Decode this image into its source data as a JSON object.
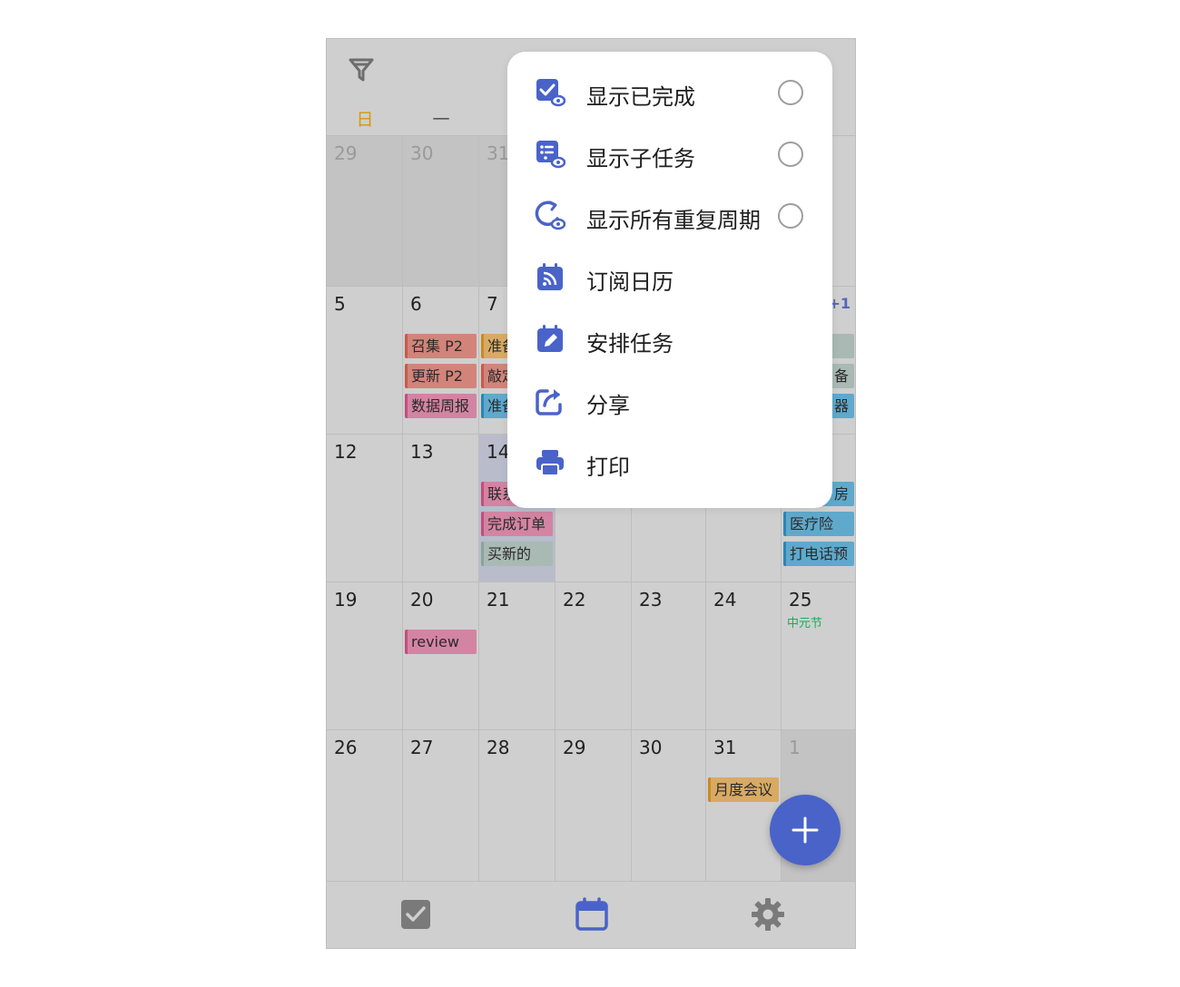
{
  "colors": {
    "accent": "#4a63c9",
    "sunday": "#d49a00",
    "holiday": "#12b05a"
  },
  "header": {
    "filter_icon": "filter-icon",
    "weekdays": [
      "日",
      "一"
    ]
  },
  "calendar": {
    "weeks": [
      [
        {
          "day": "29",
          "out": true
        },
        {
          "day": "30",
          "out": true
        },
        {
          "day": "31",
          "out": true
        },
        {
          "day": ""
        },
        {
          "day": ""
        },
        {
          "day": ""
        },
        {
          "day": ""
        }
      ],
      [
        {
          "day": "5"
        },
        {
          "day": "6",
          "events": [
            {
              "text": "召集 P2",
              "color": "red"
            },
            {
              "text": "更新 P2",
              "color": "red"
            },
            {
              "text": "数据周报",
              "color": "pink"
            }
          ]
        },
        {
          "day": "7",
          "events": [
            {
              "text": "准备",
              "color": "orange"
            },
            {
              "text": "敲定",
              "color": "red"
            },
            {
              "text": "准备",
              "color": "blue"
            }
          ]
        },
        {
          "day": ""
        },
        {
          "day": ""
        },
        {
          "day": ""
        },
        {
          "day": "",
          "more": "+1",
          "events": [
            {
              "text": "",
              "color": "gray"
            },
            {
              "text": "备",
              "color": "gray"
            },
            {
              "text": "器",
              "color": "blue"
            }
          ]
        }
      ],
      [
        {
          "day": "12"
        },
        {
          "day": "13"
        },
        {
          "day": "14",
          "today": true,
          "events": [
            {
              "text": "联系",
              "color": "pink"
            },
            {
              "text": "完成订单",
              "color": "pink"
            },
            {
              "text": "买新的",
              "color": "gray"
            }
          ]
        },
        {
          "day": ""
        },
        {
          "day": ""
        },
        {
          "day": ""
        },
        {
          "day": "",
          "events": [
            {
              "text": "房",
              "color": "blue"
            },
            {
              "text": "医疗险",
              "color": "blue"
            },
            {
              "text": "打电话预",
              "color": "blue"
            }
          ]
        }
      ],
      [
        {
          "day": "19"
        },
        {
          "day": "20",
          "events": [
            {
              "text": "review",
              "color": "pink"
            }
          ]
        },
        {
          "day": "21"
        },
        {
          "day": "22"
        },
        {
          "day": "23"
        },
        {
          "day": "24"
        },
        {
          "day": "25",
          "holiday": "中元节"
        }
      ],
      [
        {
          "day": "26"
        },
        {
          "day": "27"
        },
        {
          "day": "28"
        },
        {
          "day": "29"
        },
        {
          "day": "30"
        },
        {
          "day": "31",
          "events": [
            {
              "text": "月度会议",
              "color": "orange"
            }
          ]
        },
        {
          "day": "1",
          "out": true
        }
      ]
    ]
  },
  "menu": {
    "items": [
      {
        "label": "显示已完成",
        "icon": "completed-eye-icon",
        "toggle": true,
        "checked": false
      },
      {
        "label": "显示子任务",
        "icon": "subtask-eye-icon",
        "toggle": true,
        "checked": false
      },
      {
        "label": "显示所有重复周期",
        "icon": "repeat-eye-icon",
        "toggle": true,
        "checked": false
      },
      {
        "label": "订阅日历",
        "icon": "subscribe-calendar-icon"
      },
      {
        "label": "安排任务",
        "icon": "schedule-task-icon"
      },
      {
        "label": "分享",
        "icon": "share-icon"
      },
      {
        "label": "打印",
        "icon": "print-icon"
      }
    ]
  },
  "tabbar": {
    "tabs": [
      {
        "icon": "task-check-icon"
      },
      {
        "icon": "calendar-icon",
        "active": true
      },
      {
        "icon": "settings-gear-icon"
      }
    ]
  },
  "fab": {
    "icon": "plus-icon"
  }
}
